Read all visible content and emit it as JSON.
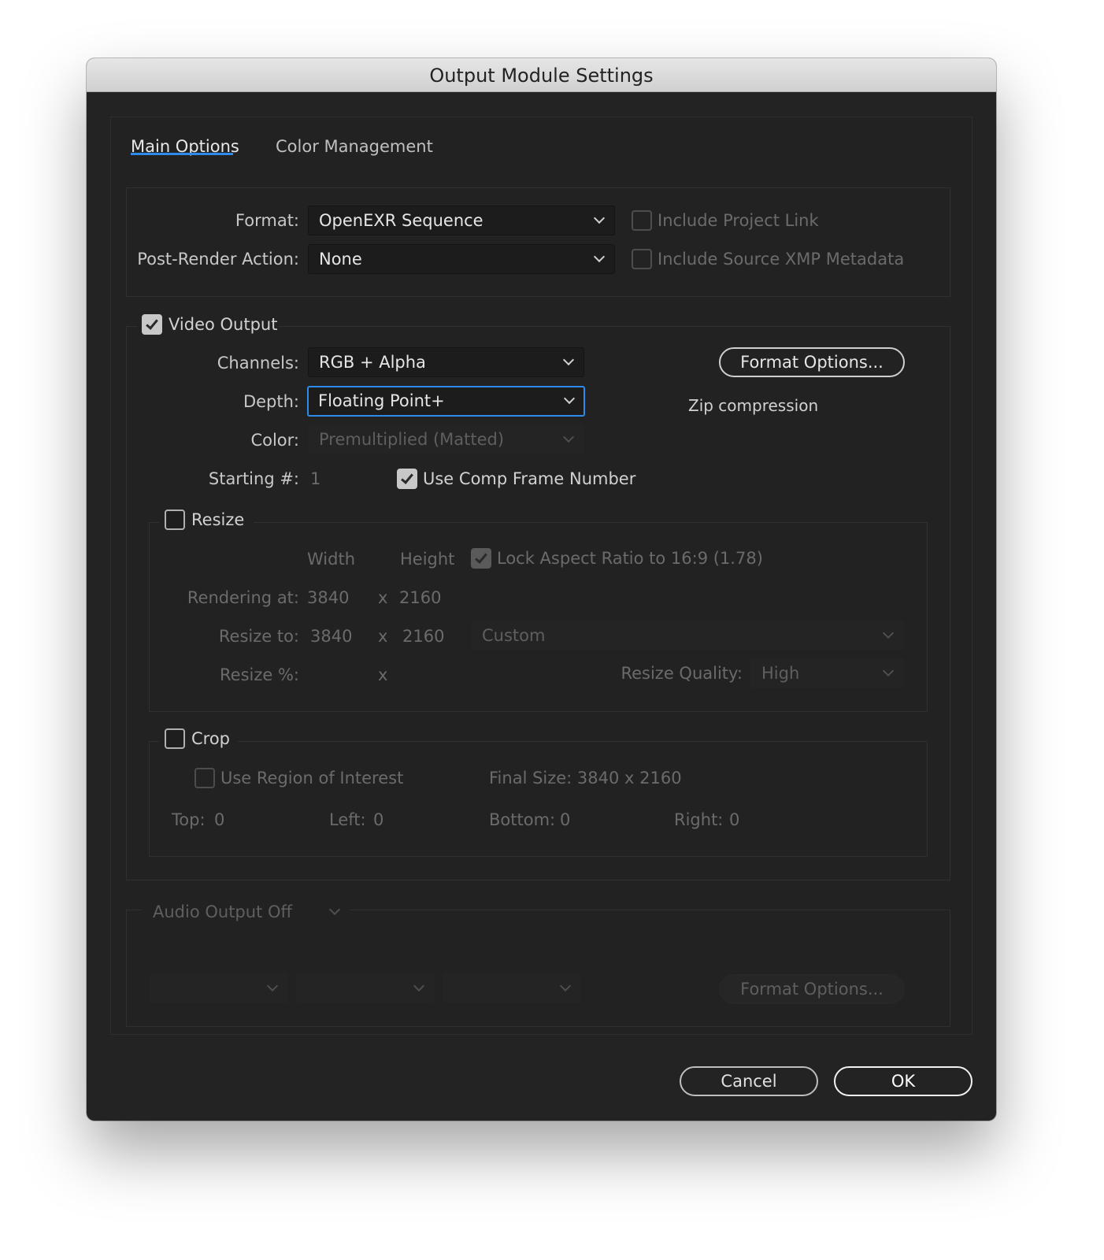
{
  "window": {
    "title": "Output Module Settings"
  },
  "tabs": [
    {
      "label": "Main Options",
      "active": true
    },
    {
      "label": "Color Management",
      "active": false
    }
  ],
  "general": {
    "format_label": "Format:",
    "format_value": "OpenEXR Sequence",
    "post_render_label": "Post-Render Action:",
    "post_render_value": "None",
    "include_project_link": {
      "label": "Include Project Link",
      "checked": false,
      "enabled": false
    },
    "include_xmp": {
      "label": "Include Source XMP Metadata",
      "checked": false,
      "enabled": false
    }
  },
  "video_output": {
    "label": "Video Output",
    "checked": true,
    "channels_label": "Channels:",
    "channels_value": "RGB + Alpha",
    "depth_label": "Depth:",
    "depth_value": "Floating Point+",
    "color_label": "Color:",
    "color_value": "Premultiplied (Matted)",
    "starting_label": "Starting #:",
    "starting_value": "1",
    "use_comp_frame": {
      "label": "Use Comp Frame Number",
      "checked": true
    },
    "format_options_button": "Format Options...",
    "compression_info": "Zip compression"
  },
  "resize": {
    "label": "Resize",
    "checked": false,
    "width_header": "Width",
    "height_header": "Height",
    "lock_aspect": {
      "label": "Lock Aspect Ratio to 16:9 (1.78)",
      "checked": true
    },
    "rendering_label": "Rendering at:",
    "rendering_width": "3840",
    "rendering_height": "2160",
    "resize_to_label": "Resize to:",
    "resize_width": "3840",
    "resize_height": "2160",
    "preset_value": "Custom",
    "percent_label": "Resize %:",
    "x_sep": "x",
    "quality_label": "Resize Quality:",
    "quality_value": "High"
  },
  "crop": {
    "label": "Crop",
    "checked": false,
    "roi_label": "Use Region of Interest",
    "final_size": "Final Size: 3840 x 2160",
    "top_label": "Top:",
    "top_value": "0",
    "left_label": "Left:",
    "left_value": "0",
    "bottom_label": "Bottom:",
    "bottom_value": "0",
    "right_label": "Right:",
    "right_value": "0"
  },
  "audio": {
    "mode_value": "Audio Output Off",
    "format_options_button": "Format Options..."
  },
  "footer": {
    "cancel": "Cancel",
    "ok": "OK"
  },
  "colors": {
    "accent": "#2d8ceb",
    "background": "#232323"
  }
}
